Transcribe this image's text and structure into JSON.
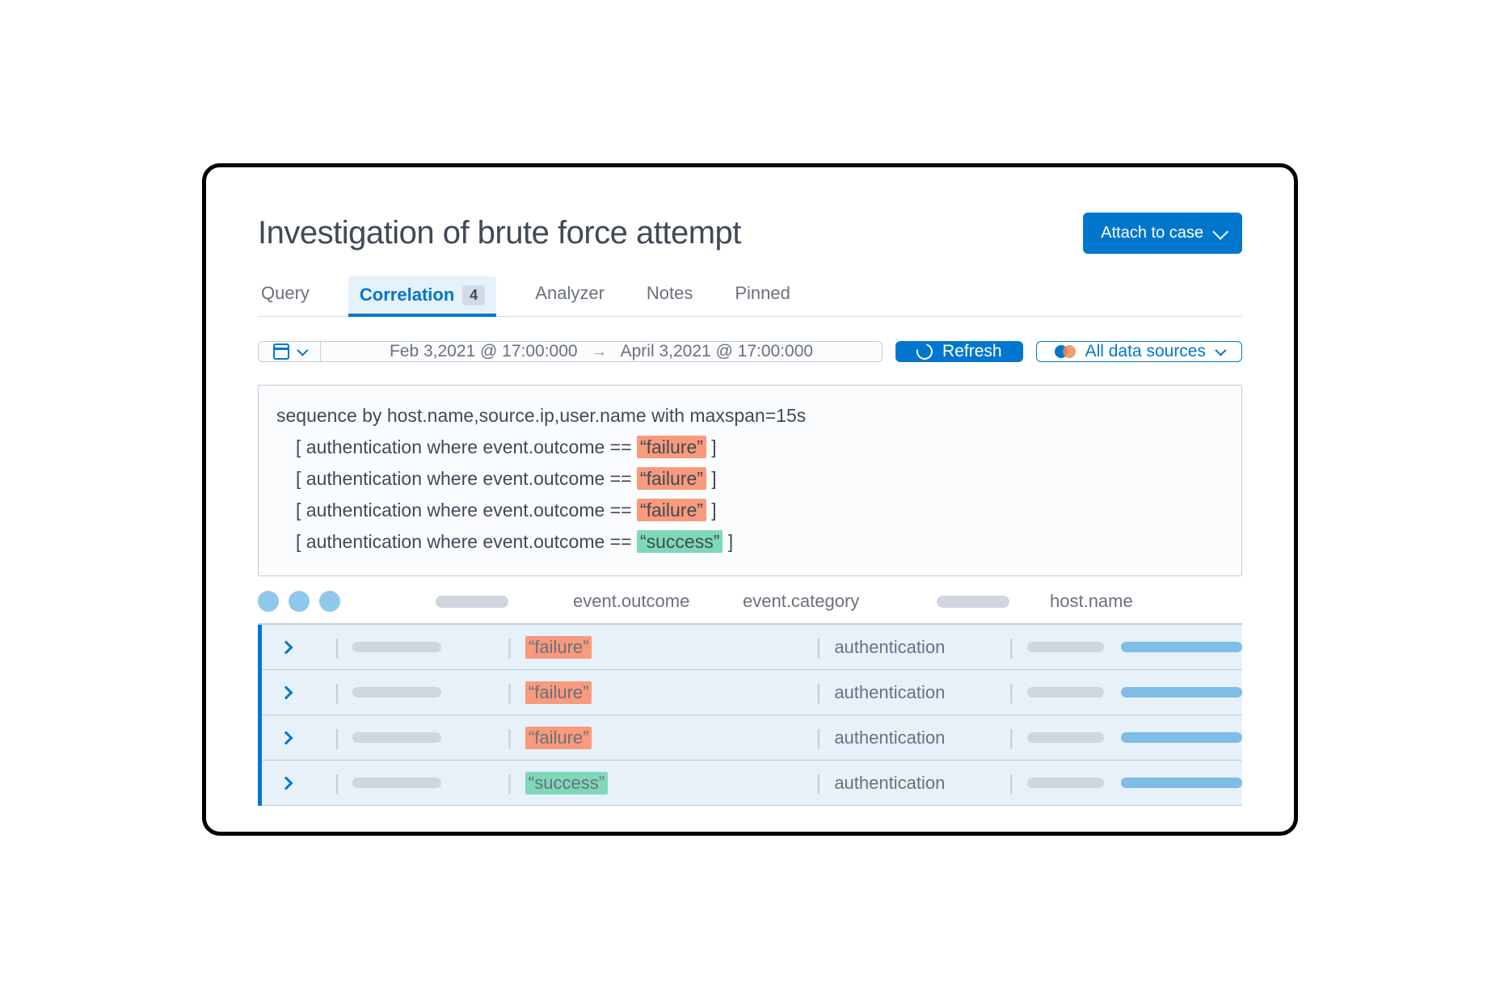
{
  "header": {
    "title": "Investigation of brute force attempt",
    "attach_label": "Attach to case"
  },
  "tabs": {
    "items": [
      "Query",
      "Correlation",
      "Analyzer",
      "Notes",
      "Pinned"
    ],
    "active_index": 1,
    "badge": "4"
  },
  "toolbar": {
    "date_from": "Feb 3,2021 @ 17:00:000",
    "date_to": "April 3,2021 @ 17:00:000",
    "refresh_label": "Refresh",
    "data_sources_label": "All data sources"
  },
  "query": {
    "line0": "sequence by host.name,source.ip,user.name with maxspan=15s",
    "clause_prefix": "[ authentication where event.outcome == ",
    "clause_suffix": " ]",
    "outcomes": [
      "“failure”",
      "“failure”",
      "“failure”",
      "“success”"
    ]
  },
  "columns": {
    "c_outcome": "event.outcome",
    "c_category": "event.category",
    "c_host": "host.name"
  },
  "rows": [
    {
      "outcome": "“failure”",
      "outcome_type": "fail",
      "category": "authentication"
    },
    {
      "outcome": "“failure”",
      "outcome_type": "fail",
      "category": "authentication"
    },
    {
      "outcome": "“failure”",
      "outcome_type": "fail",
      "category": "authentication"
    },
    {
      "outcome": "“success”",
      "outcome_type": "succ",
      "category": "authentication"
    }
  ],
  "colors": {
    "primary": "#0077cc",
    "fail_hl": "#f89a7b",
    "succ_hl": "#7fd8b8"
  }
}
